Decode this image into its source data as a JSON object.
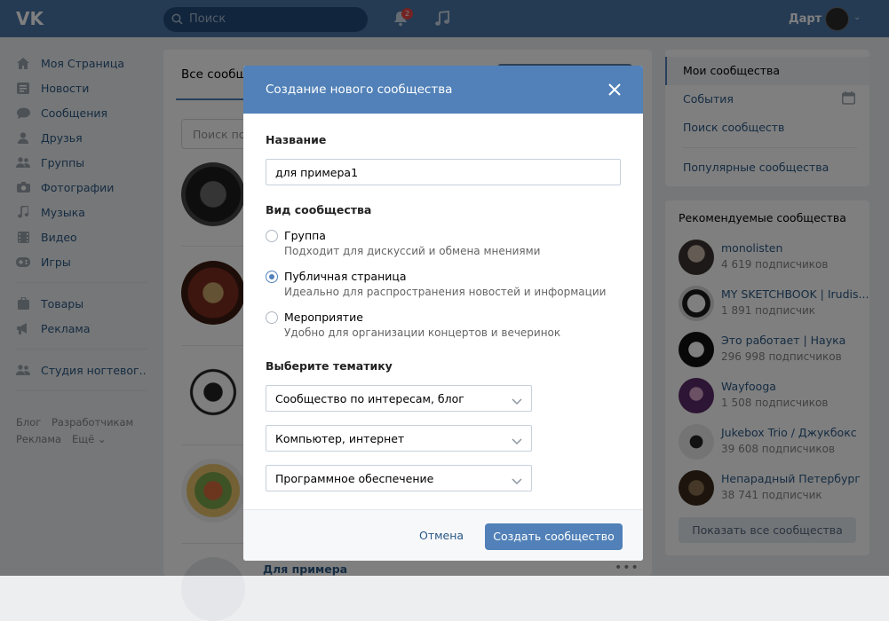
{
  "header": {
    "search_placeholder": "Поиск",
    "notification_count": "2",
    "user_name": "Дарт",
    "logo_icon": "vk-logo-icon"
  },
  "left_nav": {
    "items": [
      {
        "label": "Моя Страница",
        "icon": "home-icon"
      },
      {
        "label": "Новости",
        "icon": "news-icon"
      },
      {
        "label": "Сообщения",
        "icon": "messages-icon"
      },
      {
        "label": "Друзья",
        "icon": "friends-icon"
      },
      {
        "label": "Группы",
        "icon": "groups-icon"
      },
      {
        "label": "Фотографии",
        "icon": "photo-icon"
      },
      {
        "label": "Музыка",
        "icon": "music-icon"
      },
      {
        "label": "Видео",
        "icon": "video-icon"
      },
      {
        "label": "Игры",
        "icon": "games-icon"
      },
      {
        "label": "Товары",
        "icon": "goods-icon"
      },
      {
        "label": "Реклама",
        "icon": "ads-icon"
      },
      {
        "label": "Студия ногтевог..",
        "icon": "group-icon"
      }
    ],
    "footer": {
      "blog": "Блог",
      "developers": "Разработчикам",
      "ads": "Реклама",
      "more": "Ещё ⌄"
    }
  },
  "center": {
    "tab_label": "Все сообщ",
    "search_placeholder": "Поиск по",
    "partial_title": "Для примера"
  },
  "right_menu": {
    "items": [
      "Мои сообщества",
      "События",
      "Поиск сообществ",
      "Популярные сообщества"
    ]
  },
  "recommended": {
    "title": "Рекомендуемые сообщества",
    "items": [
      {
        "name": "monolisten",
        "subs": "4 619 подписчиков"
      },
      {
        "name": "MY SKETCHBOOK | Irudis...",
        "subs": "1 891 подписчик"
      },
      {
        "name": "Это работает | Наука",
        "subs": "296 998 подписчиков"
      },
      {
        "name": "Wayfooga",
        "subs": "1 508 подписчиков"
      },
      {
        "name": "Jukebox Trio / Джукбокс",
        "subs": "39 608 подписчиков"
      },
      {
        "name": "Непарадный Петербург",
        "subs": "38 741 подписчик"
      }
    ],
    "show_all": "Показать все сообщества"
  },
  "modal": {
    "title": "Создание нового сообщества",
    "name_label": "Название",
    "name_value": "для примера1",
    "type_label": "Вид сообщества",
    "types": [
      {
        "title": "Группа",
        "desc": "Подходит для дискуссий и обмена мнениями",
        "selected": false
      },
      {
        "title": "Публичная страница",
        "desc": "Идеально для распространения новостей и информации",
        "selected": true
      },
      {
        "title": "Мероприятие",
        "desc": "Удобно для организации концертов и вечеринок",
        "selected": false
      }
    ],
    "theme_label": "Выберите тематику",
    "selects": [
      "Сообщество по интересам, блог",
      "Компьютер, интернет",
      "Программное обеспечение"
    ],
    "cancel": "Отмена",
    "create": "Создать сообщество"
  },
  "colors": {
    "header": "#4a76a8",
    "accent": "#5181b8",
    "link": "#2a5885",
    "overlay": "rgba(0,0,0,0.5)"
  }
}
